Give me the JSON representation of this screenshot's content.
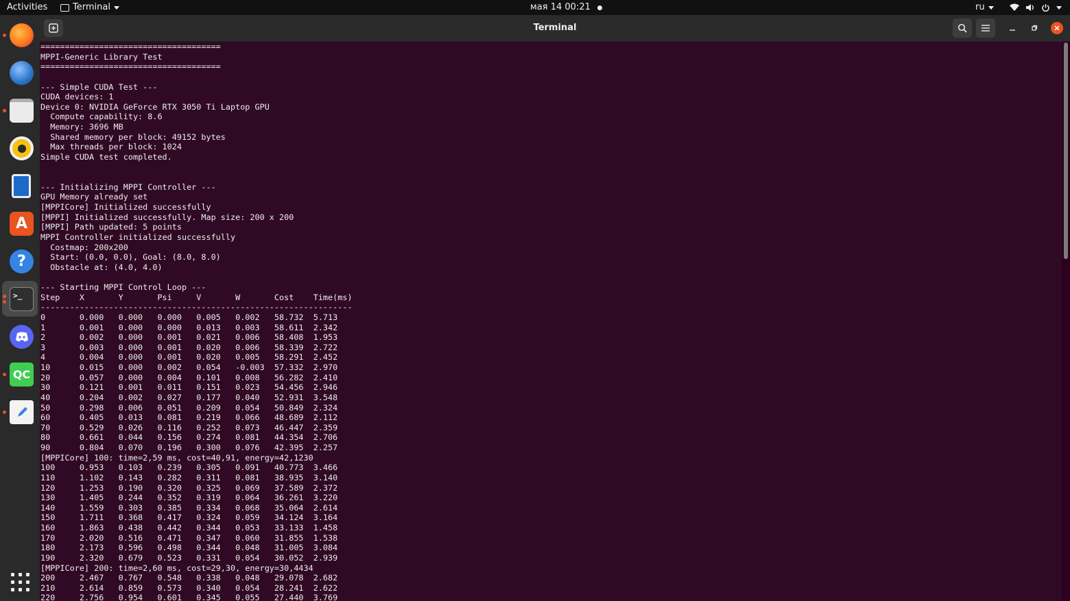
{
  "topbar": {
    "activities": "Activities",
    "app_name": "Terminal",
    "clock": "мая 14  00:21",
    "lang": "ru"
  },
  "window": {
    "title": "Terminal"
  },
  "dock": {
    "apps": [
      {
        "name": "firefox",
        "color": "#ff7a1a"
      },
      {
        "name": "thunderbird",
        "color": "#2a74c9"
      },
      {
        "name": "files",
        "color": "#ebebeb"
      },
      {
        "name": "rhythmbox",
        "color": "#f5c211"
      },
      {
        "name": "libreoffice-writer",
        "color": "#1b6ac9"
      },
      {
        "name": "app-center",
        "color": "#e95420"
      },
      {
        "name": "help",
        "color": "#3584e4"
      },
      {
        "name": "terminal",
        "color": "#2f2f2f"
      },
      {
        "name": "discord",
        "color": "#5865f2"
      },
      {
        "name": "qt-creator",
        "color": "#41cd52"
      },
      {
        "name": "text-editor",
        "color": "#f3f3f3"
      }
    ],
    "accent": "#e95420"
  },
  "terminal": {
    "lines": [
      "=====================================",
      "MPPI-Generic Library Test",
      "=====================================",
      "",
      "--- Simple CUDA Test ---",
      "CUDA devices: 1",
      "Device 0: NVIDIA GeForce RTX 3050 Ti Laptop GPU",
      "  Compute capability: 8.6",
      "  Memory: 3696 MB",
      "  Shared memory per block: 49152 bytes",
      "  Max threads per block: 1024",
      "Simple CUDA test completed.",
      "",
      "",
      "--- Initializing MPPI Controller ---",
      "GPU Memory already set",
      "[MPPICore] Initialized successfully",
      "[MPPI] Initialized successfully. Map size: 200 x 200",
      "[MPPI] Path updated: 5 points",
      "MPPI Controller initialized successfully",
      "  Costmap: 200x200",
      "  Start: (0.0, 0.0), Goal: (8.0, 8.0)",
      "  Obstacle at: (4.0, 4.0)",
      "",
      "--- Starting MPPI Control Loop ---",
      "Step    X       Y       Psi     V       W       Cost    Time(ms)",
      "----------------------------------------------------------------",
      "0       0.000   0.000   0.000   0.005   0.002   58.732  5.713",
      "1       0.001   0.000   0.000   0.013   0.003   58.611  2.342",
      "2       0.002   0.000   0.001   0.021   0.006   58.408  1.953",
      "3       0.003   0.000   0.001   0.020   0.006   58.339  2.722",
      "4       0.004   0.000   0.001   0.020   0.005   58.291  2.452",
      "10      0.015   0.000   0.002   0.054   -0.003  57.332  2.970",
      "20      0.057   0.000   0.004   0.101   0.008   56.282  2.410",
      "30      0.121   0.001   0.011   0.151   0.023   54.456  2.946",
      "40      0.204   0.002   0.027   0.177   0.040   52.931  3.548",
      "50      0.298   0.006   0.051   0.209   0.054   50.849  2.324",
      "60      0.405   0.013   0.081   0.219   0.066   48.689  2.112",
      "70      0.529   0.026   0.116   0.252   0.073   46.447  2.359",
      "80      0.661   0.044   0.156   0.274   0.081   44.354  2.706",
      "90      0.804   0.070   0.196   0.300   0.076   42.395  2.257",
      "[MPPICore] 100: time=2,59 ms, cost=40,91, energy=42,1230",
      "100     0.953   0.103   0.239   0.305   0.091   40.773  3.466",
      "110     1.102   0.143   0.282   0.311   0.081   38.935  3.140",
      "120     1.253   0.190   0.320   0.325   0.069   37.589  2.372",
      "130     1.405   0.244   0.352   0.319   0.064   36.261  3.220",
      "140     1.559   0.303   0.385   0.334   0.068   35.064  2.614",
      "150     1.711   0.368   0.417   0.324   0.059   34.124  3.164",
      "160     1.863   0.438   0.442   0.344   0.053   33.133  1.458",
      "170     2.020   0.516   0.471   0.347   0.060   31.855  1.538",
      "180     2.173   0.596   0.498   0.344   0.048   31.005  3.084",
      "190     2.320   0.679   0.523   0.331   0.054   30.052  2.939",
      "[MPPICore] 200: time=2,60 ms, cost=29,30, energy=30,4434",
      "200     2.467   0.767   0.548   0.338   0.048   29.078  2.682",
      "210     2.614   0.859   0.573   0.340   0.054   28.241  2.622",
      "220     2.756   0.954   0.601   0.345   0.055   27.440  3.769"
    ]
  }
}
